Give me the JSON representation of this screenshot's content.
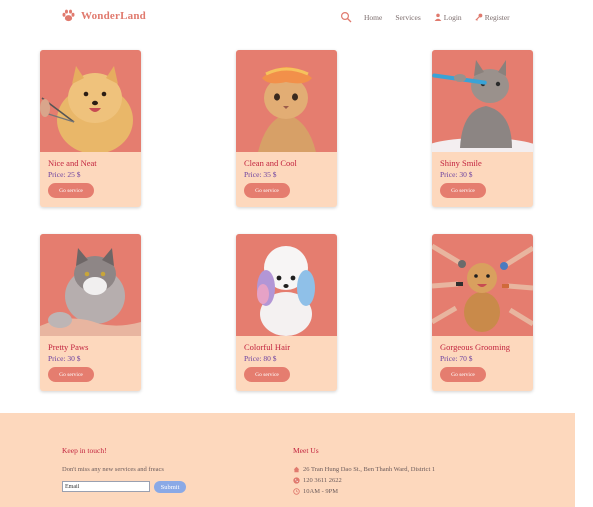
{
  "brand": {
    "name": "WonderLand",
    "icon": "paw-icon"
  },
  "nav": {
    "home": "Home",
    "services": "Services",
    "login": "Login",
    "register": "Register"
  },
  "cards": [
    {
      "title": "Nice and Neat",
      "price": "Price: 25 $",
      "button": "Go service"
    },
    {
      "title": "Clean and Cool",
      "price": "Price: 35 $",
      "button": "Go service"
    },
    {
      "title": "Shiny Smile",
      "price": "Price: 30 $",
      "button": "Go service"
    },
    {
      "title": "Pretty Paws",
      "price": "Price: 30 $",
      "button": "Go service"
    },
    {
      "title": "Colorful Hair",
      "price": "Price: 80 $",
      "button": "Go service"
    },
    {
      "title": "Gorgeous Grooming",
      "price": "Price: 70 $",
      "button": "Go service"
    }
  ],
  "footer": {
    "newsletter": {
      "heading": "Keep in touch!",
      "text": "Don't miss any new services and freacs",
      "email_value": "Email",
      "submit": "Submit"
    },
    "meet": {
      "heading": "Meet Us",
      "address": "26 Tran Hung Dao St., Ben Thanh Ward, District 1",
      "phone": "120 3611 2622",
      "hours": "10AM - 9PM"
    }
  },
  "colors": {
    "accent": "#e57d6f",
    "card_bg": "#fdd8bd",
    "title": "#c2233e",
    "price": "#6a3fa0",
    "submit": "#8aa9e6"
  }
}
